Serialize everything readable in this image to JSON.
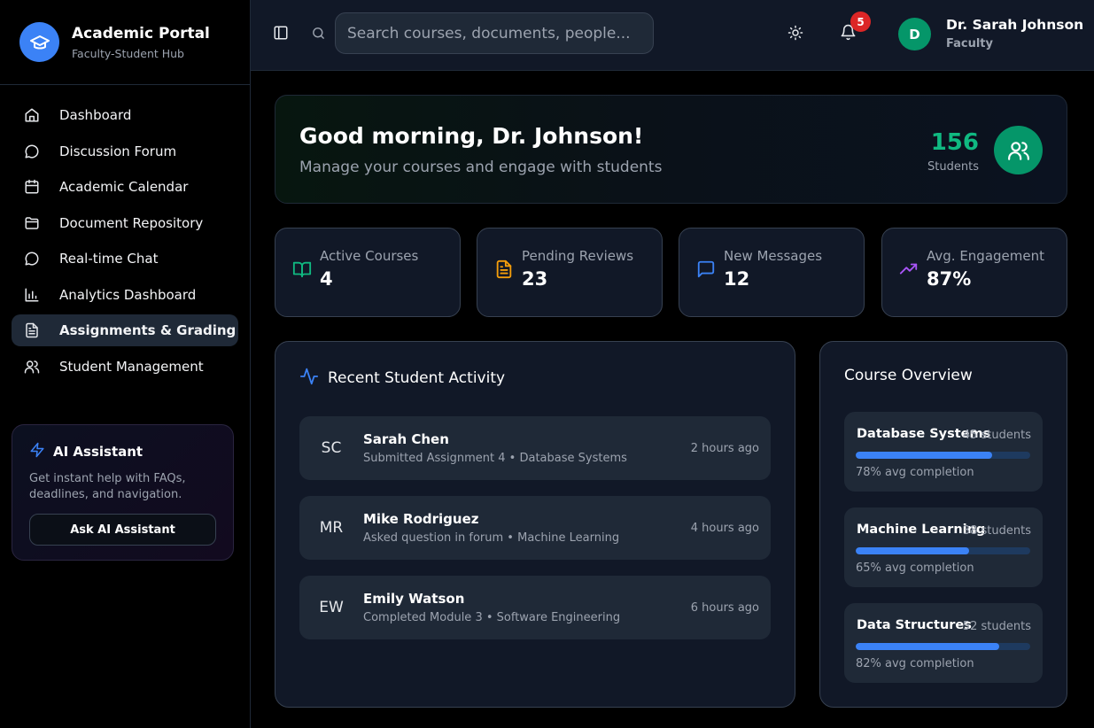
{
  "brand": {
    "title": "Academic Portal",
    "subtitle": "Faculty-Student Hub"
  },
  "sidebar": {
    "items": [
      {
        "label": "Dashboard",
        "icon": "home-icon"
      },
      {
        "label": "Discussion Forum",
        "icon": "message-circle-icon"
      },
      {
        "label": "Academic Calendar",
        "icon": "calendar-icon"
      },
      {
        "label": "Document Repository",
        "icon": "folder-icon"
      },
      {
        "label": "Real-time Chat",
        "icon": "chat-icon"
      },
      {
        "label": "Analytics Dashboard",
        "icon": "bar-chart-icon"
      },
      {
        "label": "Assignments & Grading",
        "icon": "file-text-icon",
        "active": true
      },
      {
        "label": "Student Management",
        "icon": "users-icon"
      }
    ]
  },
  "ai_assistant": {
    "title": "AI Assistant",
    "description": "Get instant help with FAQs, deadlines, and navigation.",
    "button_label": "Ask AI Assistant"
  },
  "header": {
    "search_placeholder": "Search courses, documents, people...",
    "notification_count": "5",
    "user": {
      "initial": "D",
      "name": "Dr. Sarah Johnson",
      "role": "Faculty"
    }
  },
  "welcome": {
    "title": "Good morning, Dr. Johnson!",
    "subtitle": "Manage your courses and engage with students",
    "student_count": "156",
    "student_label": "Students"
  },
  "stats": [
    {
      "label": "Active Courses",
      "value": "4",
      "icon": "book-open-icon",
      "color": "#10b981"
    },
    {
      "label": "Pending Reviews",
      "value": "23",
      "icon": "file-text-icon",
      "color": "#f59e0b"
    },
    {
      "label": "New Messages",
      "value": "12",
      "icon": "message-square-icon",
      "color": "#3b82f6"
    },
    {
      "label": "Avg. Engagement",
      "value": "87%",
      "icon": "trending-up-icon",
      "color": "#a855f7"
    }
  ],
  "activity": {
    "title": "Recent Student Activity",
    "items": [
      {
        "initials": "SC",
        "name": "Sarah Chen",
        "description": "Submitted Assignment 4 • Database Systems",
        "time": "2 hours ago"
      },
      {
        "initials": "MR",
        "name": "Mike Rodriguez",
        "description": "Asked question in forum • Machine Learning",
        "time": "4 hours ago"
      },
      {
        "initials": "EW",
        "name": "Emily Watson",
        "description": "Completed Module 3 • Software Engineering",
        "time": "6 hours ago"
      }
    ]
  },
  "overview": {
    "title": "Course Overview",
    "courses": [
      {
        "name": "Database Systems",
        "students": "45 students",
        "completion": 78,
        "completion_text": "78% avg completion"
      },
      {
        "name": "Machine Learning",
        "students": "38 students",
        "completion": 65,
        "completion_text": "65% avg completion"
      },
      {
        "name": "Data Structures",
        "students": "52 students",
        "completion": 82,
        "completion_text": "82% avg completion"
      }
    ]
  },
  "colors": {
    "accent": "#3b82f6",
    "success": "#059669",
    "badge": "#dc2626"
  }
}
